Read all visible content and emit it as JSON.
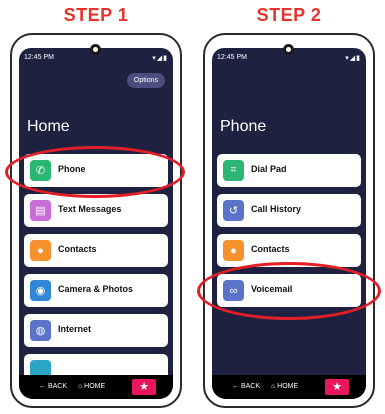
{
  "steps": [
    {
      "title": "STEP 1",
      "status_time": "12:45 PM",
      "status_icons": "▾◢▮",
      "options_label": "Options",
      "screen_title": "Home",
      "items": [
        {
          "label": "Phone",
          "icon": "phone-icon",
          "glyph": "✆",
          "color": "#2bb673"
        },
        {
          "label": "Text Messages",
          "icon": "message-icon",
          "glyph": "▤",
          "color": "#c86dd7"
        },
        {
          "label": "Contacts",
          "icon": "contacts-icon",
          "glyph": "●",
          "color": "#f5922b"
        },
        {
          "label": "Camera & Photos",
          "icon": "camera-icon",
          "glyph": "◉",
          "color": "#2f87d6"
        },
        {
          "label": "Internet",
          "icon": "internet-icon",
          "glyph": "◍",
          "color": "#5b73c9"
        },
        {
          "label": "",
          "icon": "app-icon",
          "glyph": "",
          "color": "#2aa6c4"
        }
      ],
      "bottom": {
        "back": "← BACK",
        "home": "⌂ HOME",
        "star": "★"
      }
    },
    {
      "title": "STEP 2",
      "status_time": "12:45 PM",
      "status_icons": "▾◢▮",
      "screen_title": "Phone",
      "items": [
        {
          "label": "Dial Pad",
          "icon": "dial-pad-icon",
          "glyph": "⌗",
          "color": "#2bb673"
        },
        {
          "label": "Call History",
          "icon": "call-history-icon",
          "glyph": "↺",
          "color": "#5b73c9"
        },
        {
          "label": "Contacts",
          "icon": "contacts-icon",
          "glyph": "●",
          "color": "#f5922b"
        },
        {
          "label": "Voicemail",
          "icon": "voicemail-icon",
          "glyph": "∞",
          "color": "#5b73c9"
        }
      ],
      "bottom": {
        "back": "← BACK",
        "home": "⌂ HOME",
        "star": "★"
      }
    }
  ],
  "colors": {
    "step_title": "#e8332b",
    "screen_bg": "#1f2140",
    "highlight": "#e21f26",
    "star_button": "#e8175d"
  }
}
